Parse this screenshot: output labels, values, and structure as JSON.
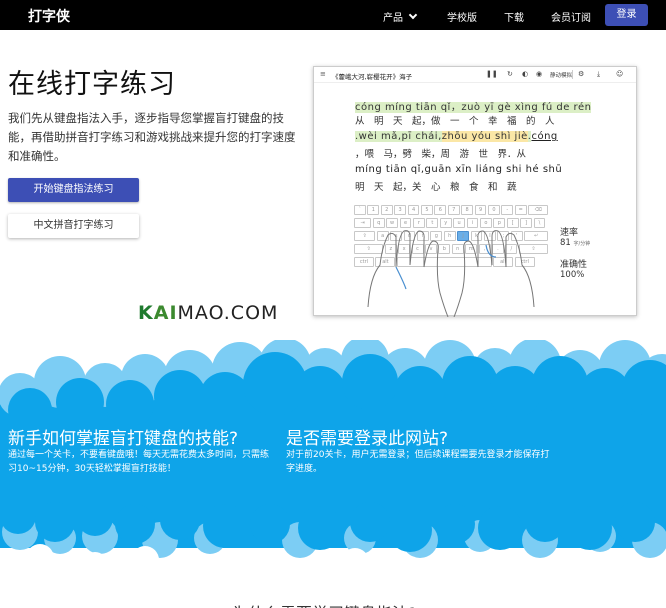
{
  "nav": {
    "brand": "打字侠",
    "links": [
      {
        "label": "产品"
      },
      {
        "label": "学校版"
      },
      {
        "label": "下载"
      },
      {
        "label": "会员订阅"
      }
    ],
    "login": "登录"
  },
  "hero": {
    "title": "在线打字练习",
    "description": "我们先从键盘指法入手，逐步指导您掌握盲打键盘的技能，再借助拼音打字练习和游戏挑战来提升您的打字速度和准确性。",
    "primary_button": "开始键盘指法练习",
    "secondary_button": "中文拼音打字练习"
  },
  "demo": {
    "title": "《藿峨大河,崭樱花开》海子",
    "toolbar_label": "静动模拟",
    "pinyin_rows": [
      [
        "cóng míng tiān qǐ",
        "，",
        "zuò yī gè xìng fú de rén"
      ],
      [
        ".wèi mǎ",
        ",",
        "pī chái",
        ",",
        "zhōu yóu shì jiè",
        ".",
        "cóng"
      ],
      [
        "míng tiān qǐ",
        ",",
        "guān xīn liáng shi hé shū"
      ]
    ],
    "hanzi_rows": [
      "从　明　天　起，做　一　个　幸　福　的　人",
      "，喂　马，劈　柴，周　游　世　界．从",
      "明　天　起，关　心　粮　食　和　蔬"
    ],
    "speed_label": "速率",
    "speed_value": "81",
    "speed_unit": "字/分钟",
    "accuracy_label": "准确性",
    "accuracy_value": "100%",
    "keyboard_rows": [
      [
        "`",
        "1",
        "2",
        "3",
        "4",
        "5",
        "6",
        "7",
        "8",
        "9",
        "0",
        "-",
        "=",
        "⌫"
      ],
      [
        "⇥",
        "q",
        "w",
        "e",
        "r",
        "t",
        "y",
        "u",
        "i",
        "o",
        "p",
        "[",
        "]",
        "\\"
      ],
      [
        "⇪",
        "a",
        "s",
        "d",
        "f",
        "g",
        "h",
        "j",
        "k",
        "l",
        ";",
        "'",
        "↵"
      ],
      [
        "⇧",
        "z",
        "x",
        "c",
        "v",
        "b",
        "n",
        "m",
        ",",
        ".",
        "/",
        "⇧"
      ],
      [
        "ctrl",
        "alt",
        "",
        "alt",
        "ctrl"
      ]
    ]
  },
  "watermark": {
    "k": "K",
    "text_mid": "AI",
    "text_end": "MAO.COM"
  },
  "section": {
    "left_title": "新手如何掌握盲打键盘的技能?",
    "left_text": "通过每一个关卡，不要看键盘哦！每天无需花费太多时间，只需练习10~15分钟，30天轻松掌握盲打技能！",
    "right_title": "是否需要登录此网站?",
    "right_text": "对于前20关卡，用户无需登录；但后续课程需要先登录才能保存打字进度。",
    "bottom_title": "为什么需要学习键盘指法?"
  },
  "colors": {
    "nav_bg": "#000000",
    "accent": "#3d4fb5",
    "sky_blue": "#0ea4e9",
    "cloud_light": "#7ccdf4",
    "pinyin_highlight": "#dcefc6"
  }
}
